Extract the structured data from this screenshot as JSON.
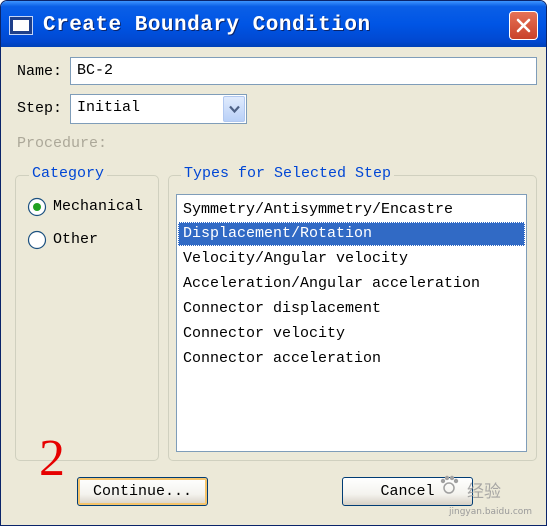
{
  "window": {
    "title": "Create Boundary Condition",
    "close_icon": "close-icon"
  },
  "form": {
    "name_label": "Name:",
    "name_value": "BC-2",
    "step_label": "Step:",
    "step_value": "Initial",
    "procedure_label": "Procedure:"
  },
  "category": {
    "legend": "Category",
    "options": [
      {
        "label": "Mechanical",
        "selected": true
      },
      {
        "label": "Other",
        "selected": false
      }
    ]
  },
  "types": {
    "legend": "Types for Selected Step",
    "items": [
      "Symmetry/Antisymmetry/Encastre",
      "Displacement/Rotation",
      "Velocity/Angular velocity",
      "Acceleration/Angular acceleration",
      "Connector displacement",
      "Connector velocity",
      "Connector acceleration"
    ],
    "selected_index": 1
  },
  "buttons": {
    "continue": "Continue...",
    "cancel": "Cancel"
  },
  "annotation": {
    "step_number": "2"
  },
  "watermark": {
    "text": "经验",
    "url": "jingyan.baidu.com"
  },
  "colors": {
    "title_bar": "#0055e5",
    "selection": "#316ac5",
    "group_label": "#0046d5",
    "annotation": "#e60000"
  }
}
